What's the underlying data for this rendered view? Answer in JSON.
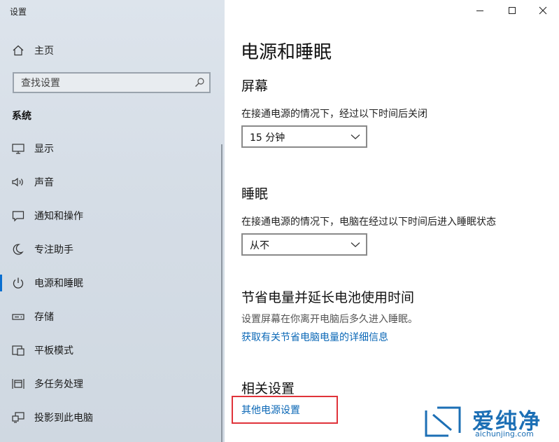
{
  "window": {
    "title": "设置",
    "controls": {
      "minimize": "minimize",
      "maximize": "maximize",
      "close": "close"
    }
  },
  "sidebar": {
    "home_label": "主页",
    "search_placeholder": "查找设置",
    "section_header": "系统",
    "items": [
      {
        "label": "显示",
        "icon": "monitor-icon",
        "selected": false
      },
      {
        "label": "声音",
        "icon": "speaker-icon",
        "selected": false
      },
      {
        "label": "通知和操作",
        "icon": "message-icon",
        "selected": false
      },
      {
        "label": "专注助手",
        "icon": "moon-icon",
        "selected": false
      },
      {
        "label": "电源和睡眠",
        "icon": "power-icon",
        "selected": true
      },
      {
        "label": "存储",
        "icon": "storage-icon",
        "selected": false
      },
      {
        "label": "平板模式",
        "icon": "tablet-icon",
        "selected": false
      },
      {
        "label": "多任务处理",
        "icon": "multitask-icon",
        "selected": false
      },
      {
        "label": "投影到此电脑",
        "icon": "project-icon",
        "selected": false
      }
    ]
  },
  "main": {
    "title": "电源和睡眠",
    "screen": {
      "heading": "屏幕",
      "description": "在接通电源的情况下，经过以下时间后关闭",
      "selected": "15 分钟"
    },
    "sleep": {
      "heading": "睡眠",
      "description": "在接通电源的情况下，电脑在经过以下时间后进入睡眠状态",
      "selected": "从不"
    },
    "battery": {
      "heading": "节省电量并延长电池使用时间",
      "description": "设置屏幕在你离开电脑后多久进入睡眠。",
      "link": "获取有关节省电脑电量的详细信息"
    },
    "related": {
      "heading": "相关设置",
      "link": "其他电源设置"
    }
  },
  "watermark": {
    "text": "爱纯净",
    "url": "aichunjing.com"
  },
  "colors": {
    "accent": "#0b6fd0",
    "link": "#0a67b6",
    "highlight": "#e0333a",
    "watermark": "#1c6fb5"
  }
}
